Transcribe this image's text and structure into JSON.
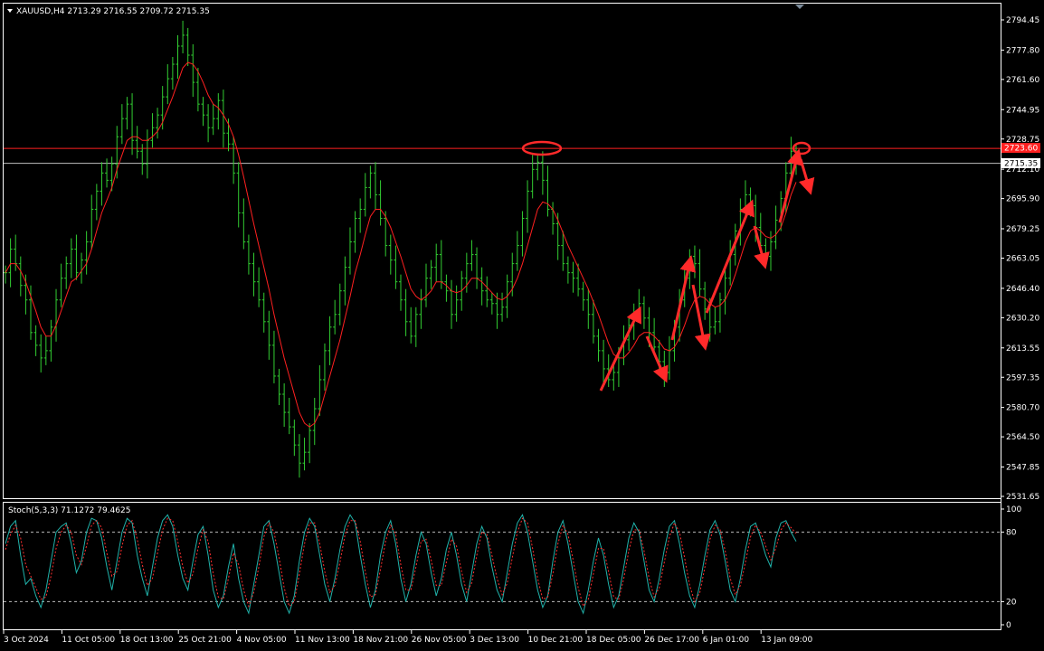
{
  "main_panel": {
    "symbol_line": "XAUUSD,H4 2713.29 2716.55 2709.72 2715.35",
    "y_ticks": [
      "2794.45",
      "2777.80",
      "2761.60",
      "2744.95",
      "2728.75",
      "2712.10",
      "2695.90",
      "2679.25",
      "2663.05",
      "2646.40",
      "2630.20",
      "2613.55",
      "2597.35",
      "2580.70",
      "2564.50",
      "2547.85",
      "2531.65"
    ],
    "resistance_label": "2723.60",
    "current_price_label": "2715.35",
    "colors": {
      "bars": "#32cd32",
      "ma": "#ff2020",
      "resistance": "#ff2020",
      "current": "#c0c0c0",
      "grid": "#ffffff",
      "annotation": "#ff2a2a"
    }
  },
  "stoch_panel": {
    "legend": "Stoch(5,3,3) 71.1272 79.4625",
    "y_ticks": [
      "100",
      "80",
      "20",
      "0"
    ],
    "colors": {
      "main": "#20b2aa",
      "signal": "#ff3030",
      "levels": "#bbbbbb"
    }
  },
  "x_axis": {
    "labels": [
      "3 Oct 2024",
      "11 Oct 05:00",
      "18 Oct 13:00",
      "25 Oct 21:00",
      "4 Nov 05:00",
      "11 Nov 13:00",
      "18 Nov 21:00",
      "26 Nov 05:00",
      "3 Dec 13:00",
      "10 Dec 21:00",
      "18 Dec 05:00",
      "26 Dec 17:00",
      "6 Jan 01:00",
      "13 Jan 09:00"
    ]
  },
  "chart_data": [
    {
      "type": "line",
      "description_type": "ohlc_bars_with_moving_average",
      "title": "XAUUSD,H4",
      "ohlc_last": {
        "open": 2713.29,
        "high": 2716.55,
        "low": 2709.72,
        "close": 2715.35
      },
      "x_labels": [
        "3 Oct 2024",
        "11 Oct 05:00",
        "18 Oct 13:00",
        "25 Oct 21:00",
        "4 Nov 05:00",
        "11 Nov 13:00",
        "18 Nov 21:00",
        "26 Nov 05:00",
        "3 Dec 13:00",
        "10 Dec 21:00",
        "18 Dec 05:00",
        "26 Dec 17:00",
        "6 Jan 01:00",
        "13 Jan 09:00"
      ],
      "ylim": [
        2531.65,
        2794.45
      ],
      "series": [
        {
          "name": "",
          "kind": "price_close",
          "values": [
            2655,
            2668,
            2660,
            2648,
            2640,
            2622,
            2615,
            2608,
            2612,
            2625,
            2640,
            2652,
            2660,
            2668,
            2655,
            2662,
            2672,
            2690,
            2700,
            2710,
            2706,
            2715,
            2730,
            2740,
            2748,
            2728,
            2722,
            2715,
            2728,
            2735,
            2742,
            2752,
            2762,
            2770,
            2780,
            2786,
            2775,
            2760,
            2748,
            2742,
            2735,
            2740,
            2750,
            2732,
            2726,
            2710,
            2688,
            2672,
            2660,
            2650,
            2640,
            2628,
            2615,
            2598,
            2588,
            2578,
            2570,
            2560,
            2550,
            2556,
            2568,
            2580,
            2596,
            2612,
            2625,
            2632,
            2645,
            2658,
            2672,
            2685,
            2690,
            2702,
            2710,
            2698,
            2685,
            2670,
            2662,
            2650,
            2640,
            2628,
            2620,
            2632,
            2640,
            2652,
            2658,
            2665,
            2650,
            2645,
            2632,
            2640,
            2652,
            2660,
            2665,
            2652,
            2645,
            2640,
            2638,
            2632,
            2636,
            2650,
            2660,
            2670,
            2685,
            2700,
            2712,
            2716,
            2706,
            2690,
            2682,
            2670,
            2660,
            2655,
            2652,
            2646,
            2640,
            2632,
            2620,
            2612,
            2602,
            2596,
            2600,
            2608,
            2618,
            2626,
            2632,
            2638,
            2630,
            2622,
            2614,
            2606,
            2600,
            2612,
            2625,
            2640,
            2652,
            2664,
            2660,
            2646,
            2635,
            2625,
            2628,
            2640,
            2652,
            2665,
            2678,
            2690,
            2698,
            2692,
            2680,
            2670,
            2664,
            2672,
            2684,
            2696,
            2710,
            2722,
            2715
          ]
        },
        {
          "name": "",
          "kind": "moving_average",
          "values": [
            2655,
            2660,
            2660,
            2656,
            2650,
            2642,
            2634,
            2625,
            2620,
            2620,
            2626,
            2634,
            2642,
            2650,
            2652,
            2656,
            2660,
            2668,
            2678,
            2688,
            2695,
            2702,
            2712,
            2720,
            2728,
            2730,
            2730,
            2728,
            2728,
            2730,
            2733,
            2738,
            2745,
            2752,
            2760,
            2768,
            2771,
            2770,
            2766,
            2760,
            2753,
            2748,
            2746,
            2742,
            2737,
            2730,
            2720,
            2708,
            2695,
            2682,
            2670,
            2658,
            2646,
            2632,
            2620,
            2608,
            2598,
            2588,
            2578,
            2572,
            2570,
            2572,
            2578,
            2588,
            2598,
            2608,
            2618,
            2630,
            2642,
            2655,
            2665,
            2676,
            2686,
            2690,
            2690,
            2686,
            2680,
            2672,
            2664,
            2655,
            2646,
            2642,
            2640,
            2642,
            2645,
            2650,
            2650,
            2648,
            2645,
            2644,
            2645,
            2648,
            2652,
            2652,
            2650,
            2647,
            2644,
            2641,
            2640,
            2642,
            2646,
            2652,
            2660,
            2670,
            2680,
            2690,
            2694,
            2693,
            2690,
            2684,
            2677,
            2670,
            2664,
            2658,
            2652,
            2646,
            2639,
            2632,
            2624,
            2616,
            2610,
            2608,
            2608,
            2611,
            2615,
            2620,
            2622,
            2622,
            2620,
            2617,
            2613,
            2612,
            2614,
            2619,
            2626,
            2634,
            2640,
            2642,
            2641,
            2638,
            2636,
            2637,
            2640,
            2646,
            2654,
            2663,
            2672,
            2678,
            2680,
            2678,
            2675,
            2674,
            2676,
            2680,
            2688,
            2698,
            2705
          ]
        }
      ],
      "horizontal_levels": [
        2723.6,
        2715.35
      ]
    },
    {
      "type": "line",
      "title": "Stoch(5,3,3)",
      "legend_values": {
        "main": 71.1272,
        "signal": 79.4625
      },
      "ylim": [
        0,
        100
      ],
      "levels": [
        80,
        20
      ],
      "series": [
        {
          "name": "",
          "values": [
            70,
            85,
            90,
            60,
            35,
            40,
            25,
            15,
            30,
            55,
            80,
            85,
            88,
            70,
            45,
            55,
            80,
            92,
            90,
            75,
            50,
            30,
            55,
            80,
            92,
            88,
            60,
            40,
            25,
            50,
            75,
            90,
            95,
            85,
            60,
            40,
            30,
            55,
            78,
            85,
            60,
            30,
            15,
            25,
            50,
            70,
            40,
            20,
            10,
            35,
            60,
            85,
            90,
            70,
            45,
            20,
            10,
            25,
            55,
            80,
            92,
            85,
            60,
            35,
            20,
            40,
            65,
            85,
            95,
            88,
            60,
            35,
            15,
            30,
            60,
            80,
            90,
            70,
            40,
            20,
            35,
            60,
            80,
            70,
            45,
            25,
            40,
            65,
            80,
            60,
            35,
            20,
            45,
            70,
            85,
            75,
            50,
            30,
            20,
            45,
            70,
            88,
            95,
            80,
            55,
            30,
            15,
            25,
            55,
            80,
            90,
            70,
            45,
            20,
            10,
            30,
            55,
            75,
            60,
            35,
            15,
            25,
            50,
            75,
            88,
            80,
            55,
            30,
            20,
            40,
            65,
            85,
            90,
            70,
            45,
            25,
            15,
            35,
            60,
            82,
            90,
            78,
            55,
            30,
            20,
            40,
            65,
            85,
            88,
            75,
            60,
            50,
            75,
            88,
            90,
            80,
            72
          ]
        },
        {
          "name": "",
          "values": [
            65,
            78,
            86,
            75,
            52,
            42,
            32,
            22,
            24,
            42,
            66,
            80,
            86,
            80,
            60,
            52,
            68,
            86,
            90,
            84,
            62,
            42,
            46,
            68,
            86,
            90,
            74,
            52,
            34,
            40,
            62,
            82,
            92,
            90,
            72,
            50,
            36,
            44,
            66,
            82,
            72,
            44,
            24,
            22,
            40,
            62,
            52,
            30,
            16,
            28,
            50,
            76,
            88,
            80,
            58,
            32,
            16,
            20,
            44,
            70,
            88,
            88,
            70,
            46,
            28,
            34,
            54,
            78,
            90,
            90,
            72,
            46,
            24,
            26,
            48,
            72,
            86,
            78,
            52,
            30,
            30,
            50,
            72,
            74,
            56,
            34,
            34,
            54,
            74,
            68,
            46,
            28,
            36,
            60,
            80,
            78,
            60,
            40,
            26,
            36,
            58,
            80,
            92,
            88,
            66,
            40,
            22,
            24,
            44,
            70,
            86,
            78,
            56,
            32,
            16,
            22,
            44,
            66,
            66,
            46,
            24,
            22,
            40,
            64,
            82,
            82,
            64,
            40,
            24,
            32,
            54,
            76,
            88,
            80,
            58,
            34,
            20,
            28,
            50,
            74,
            86,
            82,
            64,
            40,
            26,
            34,
            54,
            76,
            86,
            80,
            68,
            56,
            66,
            82,
            88,
            84,
            79
          ]
        }
      ]
    }
  ]
}
